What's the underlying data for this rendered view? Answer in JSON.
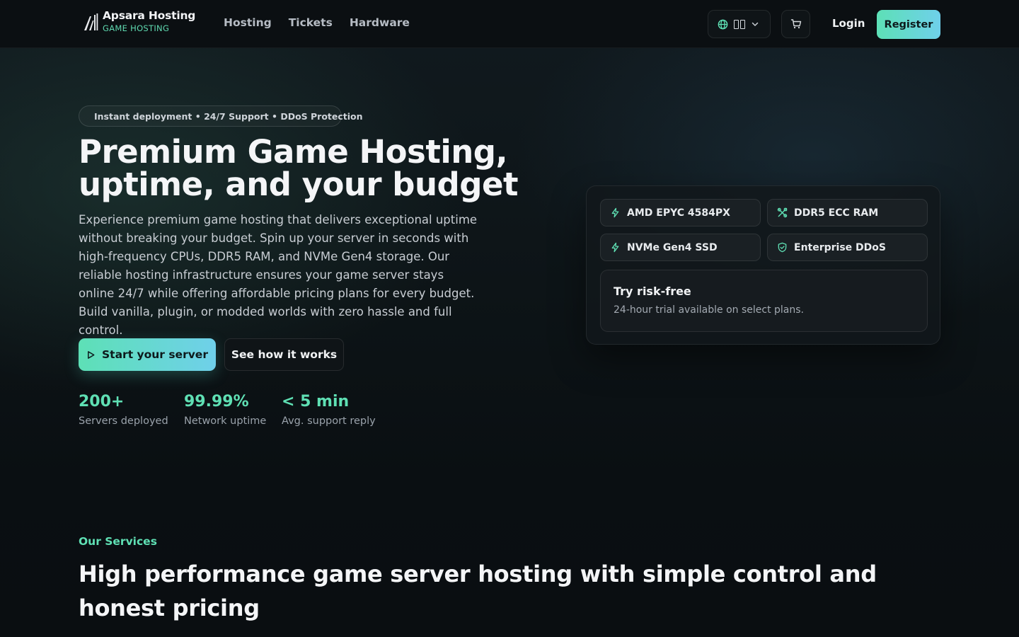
{
  "brand": {
    "name": "Apsara Hosting",
    "tagline": "GAME HOSTING",
    "logo_icon": "apsara-logo-icon"
  },
  "nav": {
    "links": [
      {
        "label": "Hosting"
      },
      {
        "label": "Tickets"
      },
      {
        "label": "Hardware"
      }
    ],
    "language_icon": "globe-icon",
    "cart_icon": "cart-icon",
    "login_label": "Login",
    "register_label": "Register"
  },
  "hero": {
    "badge_text": "Instant deployment • 24/7 Support • DDoS Protection",
    "badge_icon": "sparkles-icon",
    "title_line1": "Premium Game Hosting,",
    "title_line2": "uptime, and your budget",
    "description": "Experience premium game hosting that delivers exceptional uptime without breaking your budget. Spin up your server in seconds with high-frequency CPUs, DDR5 RAM, and NVMe Gen4 storage. Our reliable hosting infrastructure ensures your game server stays online 24/7 while offering affordable pricing plans for every budget. Build vanilla, plugin, or modded worlds with zero hassle and full control.",
    "cta_primary": "Start your server",
    "cta_secondary": "See how it works",
    "stats": [
      {
        "value": "200+",
        "label": "Servers deployed"
      },
      {
        "value": "99.99%",
        "label": "Network uptime"
      },
      {
        "value": "< 5 min",
        "label": "Avg. support reply"
      }
    ]
  },
  "specs": {
    "items": [
      {
        "label": "AMD EPYC 4584PX",
        "icon": "bolt-icon"
      },
      {
        "label": "DDR5 ECC RAM",
        "icon": "tools-icon"
      },
      {
        "label": "NVMe Gen4 SSD",
        "icon": "bolt-icon"
      },
      {
        "label": "Enterprise DDoS",
        "icon": "shield-check-icon"
      }
    ],
    "trial_title": "Try risk-free",
    "trial_text": "24-hour trial available on select plans."
  },
  "services": {
    "label": "Our Services",
    "title": "High performance game server hosting with simple control and honest pricing"
  },
  "colors": {
    "accent_green": "#5fe0b4",
    "accent_gradient_start": "#5de0b6",
    "accent_gradient_end": "#6fd0ea",
    "background": "#0b0f12"
  }
}
